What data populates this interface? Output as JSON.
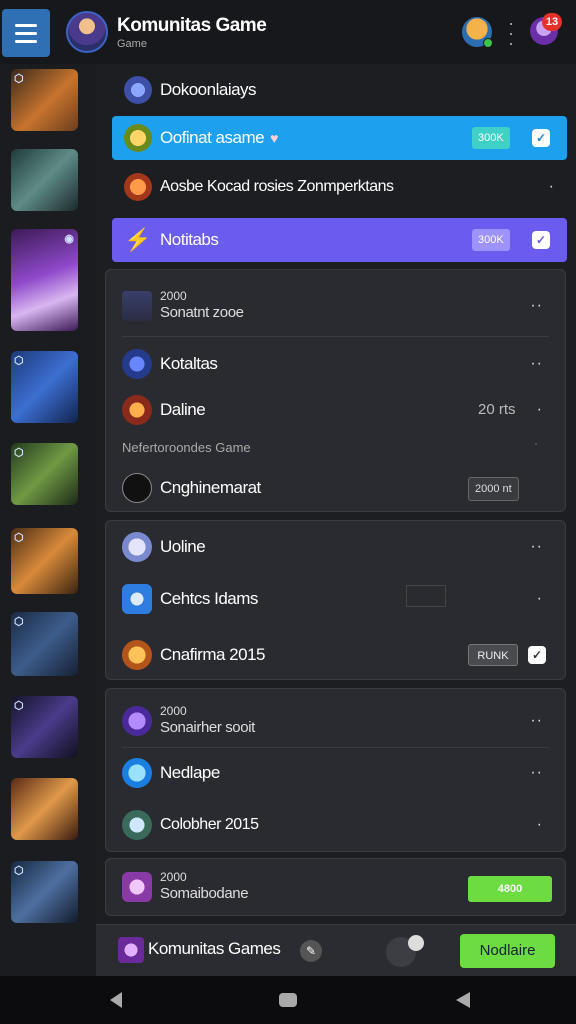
{
  "header": {
    "title": "Komunitas Game",
    "subtitle": "Game",
    "notification_count": "13"
  },
  "sidebar": {
    "thumbnails": [
      {
        "icon": "game-hero-1"
      },
      {
        "icon": "game-hero-2"
      },
      {
        "icon": "game-hero-3"
      },
      {
        "icon": "game-hero-4"
      },
      {
        "icon": "game-hero-5"
      },
      {
        "icon": "game-hero-6"
      },
      {
        "icon": "game-hero-7"
      },
      {
        "icon": "game-hero-8"
      },
      {
        "icon": "game-hero-9"
      },
      {
        "icon": "game-hero-10"
      }
    ]
  },
  "main": {
    "row1": {
      "label": "Dokoonlaiays"
    },
    "row2": {
      "label": "Oofinat asame",
      "pill": "300K"
    },
    "row3": {
      "label": "Aosbe Kocad rosies Zonmperktans"
    },
    "row4": {
      "label": "Notitabs",
      "pill": "300K"
    },
    "panel1": {
      "item1": {
        "top": "2000",
        "bottom": "Sonatnt zooe"
      },
      "item2": {
        "label": "Kotaltas"
      },
      "item3": {
        "label": "Daline",
        "value": "20 rts"
      },
      "item4": {
        "label": "Nefertoroondes Game"
      },
      "item5": {
        "label": "Cnghinemarat",
        "pill": "2000 nt"
      }
    },
    "panel2": {
      "item1": {
        "label": "Uoline"
      },
      "item2": {
        "label": "Cehtcs Idams"
      },
      "item3": {
        "label": "Cnafirma 2015",
        "pill": "RUNK"
      }
    },
    "panel3": {
      "item1": {
        "top": "2000",
        "bottom": "Sonairher sooit"
      },
      "item2": {
        "label": "Nedlape"
      },
      "item3": {
        "label": "Colobher 2015"
      }
    },
    "panel4": {
      "item1": {
        "top": "2000",
        "bottom": "Somaibodane",
        "pill": "4800"
      }
    }
  },
  "bottombar": {
    "label": "Komunitas Games",
    "action": "Nodlaire"
  },
  "colors": {
    "accent_blue": "#1da1ee",
    "accent_purple": "#6b5cf0",
    "accent_green": "#6cdc40",
    "badge_red": "#e4322b"
  }
}
